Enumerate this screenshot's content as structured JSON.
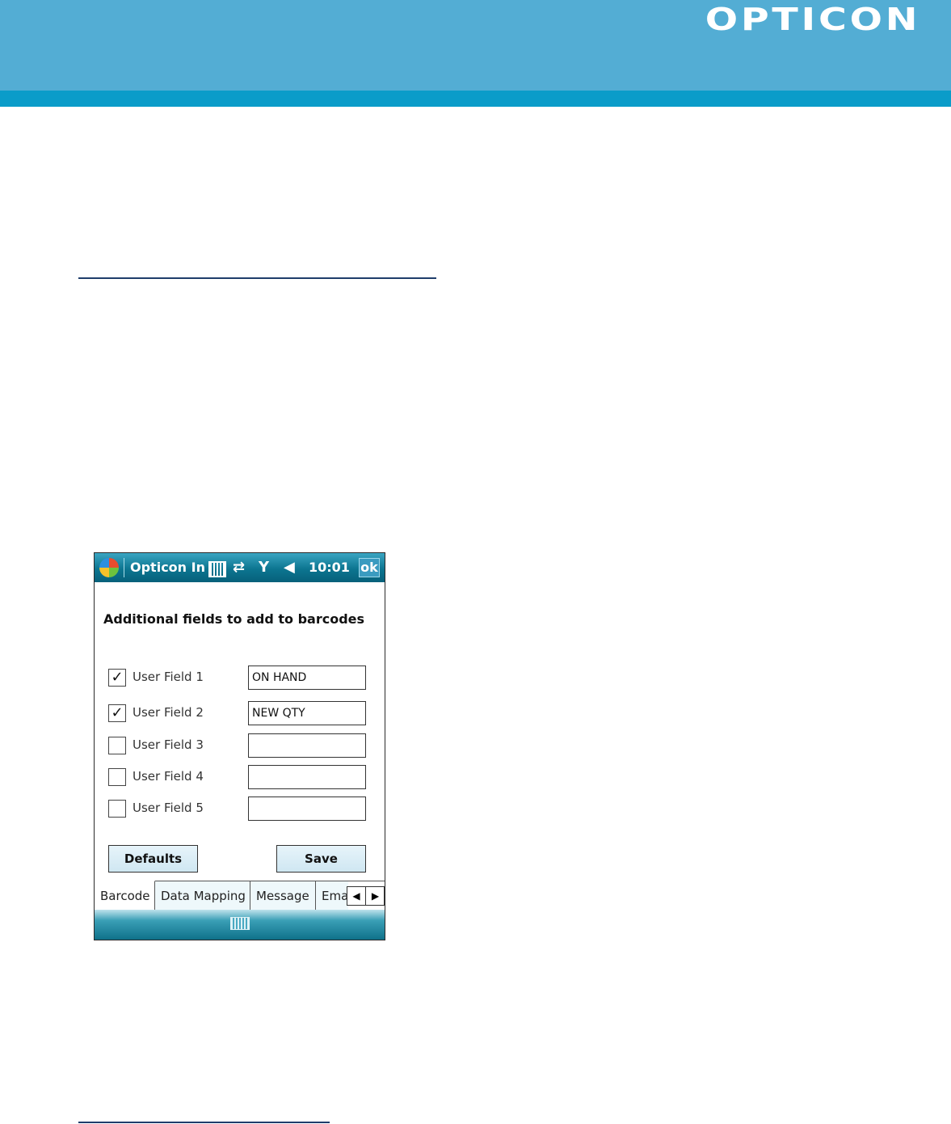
{
  "page": {
    "logo": "OPTICON"
  },
  "device": {
    "titlebar": {
      "title": "Opticon In",
      "time": "10:01",
      "ok_label": "ok",
      "icons": [
        "windows-start-icon",
        "barcode-icon",
        "sync-icon",
        "signal-off-icon",
        "volume-icon"
      ]
    },
    "heading": "Additional fields to add to barcodes",
    "fields": [
      {
        "label": "User Field 1",
        "checked": true,
        "value": "ON HAND"
      },
      {
        "label": "User Field 2",
        "checked": true,
        "value": "NEW QTY"
      },
      {
        "label": "User Field 3",
        "checked": false,
        "value": ""
      },
      {
        "label": "User Field 4",
        "checked": false,
        "value": ""
      },
      {
        "label": "User Field 5",
        "checked": false,
        "value": ""
      }
    ],
    "buttons": {
      "defaults": "Defaults",
      "save": "Save"
    },
    "tabs": [
      {
        "label": "Barcode",
        "active": true
      },
      {
        "label": "Data Mapping",
        "active": false
      },
      {
        "label": "Message",
        "active": false
      },
      {
        "label": "Ema",
        "active": false
      }
    ],
    "tab_arrows": {
      "left": "◀",
      "right": "▶"
    },
    "check_mark": "✓"
  },
  "colors": {
    "header": "#53add4",
    "header_stripe": "#0a9cc9",
    "titlebar": "#0c7590"
  }
}
